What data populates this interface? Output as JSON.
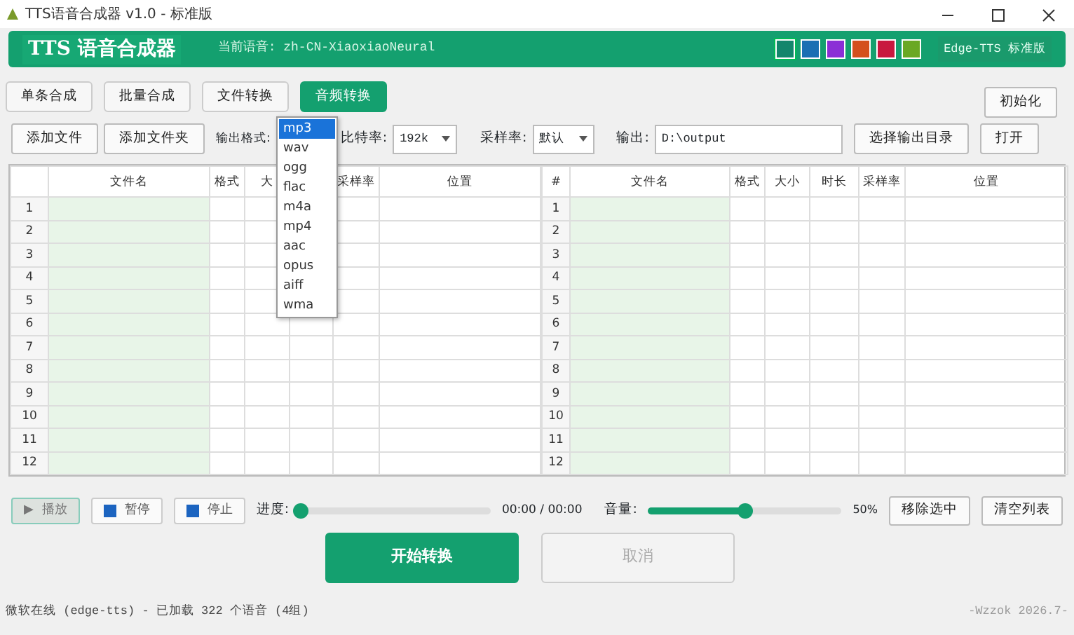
{
  "window": {
    "title": "TTS语音合成器 v1.0 - 标准版"
  },
  "header": {
    "logo": "TTS 语音合成器",
    "voice_label": "当前语音:",
    "voice": "zh-CN-XiaoxiaoNeural",
    "badge": "Edge-TTS 标准版",
    "swatches": [
      {
        "color": "#13866c",
        "selected": true
      },
      {
        "color": "#1a6fb3",
        "selected": false
      },
      {
        "color": "#8b2fd6",
        "selected": false
      },
      {
        "color": "#d4501c",
        "selected": false
      },
      {
        "color": "#c8183f",
        "selected": false
      },
      {
        "color": "#6aa824",
        "selected": false
      }
    ]
  },
  "tabs": [
    {
      "label": "单条合成",
      "selected": false
    },
    {
      "label": "批量合成",
      "selected": false
    },
    {
      "label": "文件转换",
      "selected": false
    },
    {
      "label": "音频转换",
      "selected": true
    }
  ],
  "reset_button": "初始化",
  "toolbar": {
    "add_file": "添加文件",
    "add_folder": "添加文件夹",
    "format_label": "输出格式:",
    "bitrate_label": "比特率:",
    "bitrate": "192k",
    "samplerate_label": "采样率:",
    "samplerate": "默认",
    "output_label": "输出:",
    "output": "D:\\output",
    "choose_dir": "选择输出目录",
    "open": "打开"
  },
  "format_menu": [
    {
      "label": "mp3",
      "selected": true
    },
    {
      "label": "wav",
      "selected": false
    },
    {
      "label": "ogg",
      "selected": false
    },
    {
      "label": "flac",
      "selected": false
    },
    {
      "label": "m4a",
      "selected": false
    },
    {
      "label": "mp4",
      "selected": false
    },
    {
      "label": "aac",
      "selected": false
    },
    {
      "label": "opus",
      "selected": false
    },
    {
      "label": "aiff",
      "selected": false
    },
    {
      "label": "wma",
      "selected": false
    }
  ],
  "source_table": {
    "columns": [
      {
        "label": "文件名"
      },
      {
        "label": "格式"
      },
      {
        "label": "大"
      },
      {},
      {
        "label": "采样率"
      },
      {
        "label": "位置"
      }
    ],
    "rows": [
      "1",
      "2",
      "3",
      "4",
      "5",
      "6",
      "7",
      "8",
      "9",
      "10",
      "11",
      "12"
    ]
  },
  "result_table": {
    "columns": [
      {
        "label": "#"
      },
      {
        "label": "文件名"
      },
      {
        "label": "格式"
      },
      {
        "label": "大小"
      },
      {
        "label": "时长"
      },
      {
        "label": "采样率"
      },
      {
        "label": "位置"
      }
    ],
    "rows": [
      "1",
      "2",
      "3",
      "4",
      "5",
      "6",
      "7",
      "8",
      "9",
      "10",
      "11",
      "12"
    ]
  },
  "player": {
    "buttons": [
      {
        "kind": "play",
        "label": "播放",
        "icon": "▶",
        "disabled": true
      },
      {
        "kind": "pause",
        "label": "暂停",
        "disabled": false
      },
      {
        "kind": "stop",
        "label": "停止",
        "disabled": false
      }
    ],
    "progress_label": "进度:",
    "progress": {
      "level": 0
    },
    "time": "00:00 / 00:00",
    "volume_label": "音量:",
    "volume": {
      "level": 0.5
    },
    "volume_reading": "50%",
    "remove_selected": "移除选中",
    "clear_list": "清空列表"
  },
  "actions": [
    {
      "label": "开始转换",
      "disabled": false
    },
    {
      "label": "取消",
      "disabled": true
    }
  ],
  "status_bar": {
    "text": "微软在线 (edge-tts) - 已加载 322 个语音 (4组)",
    "version": "-Wzzok 2026.7-"
  }
}
